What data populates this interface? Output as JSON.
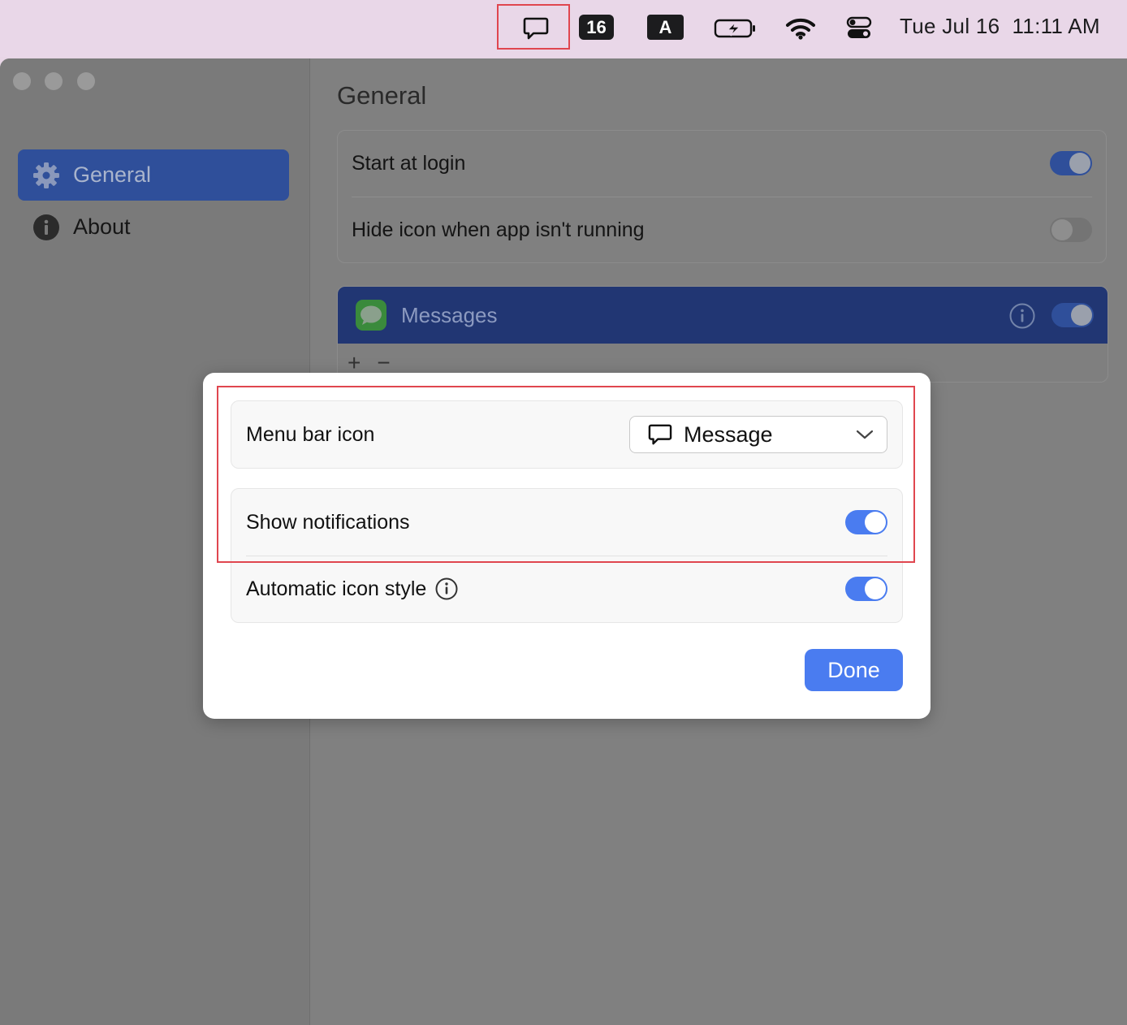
{
  "menubar": {
    "badge_number": "16",
    "input_letter": "A",
    "clock": "Tue Jul 16  11:11 AM",
    "icons": [
      "message-icon",
      "battery-charging-icon",
      "wifi-icon",
      "control-center-icon"
    ]
  },
  "sidebar": {
    "items": [
      {
        "label": "General",
        "icon": "gear-icon",
        "active": true
      },
      {
        "label": "About",
        "icon": "info-icon",
        "active": false
      }
    ]
  },
  "general": {
    "title": "General",
    "start_at_login": {
      "label": "Start at login",
      "on": true
    },
    "hide_icon": {
      "label": "Hide icon when app isn't running",
      "on": false
    }
  },
  "apps": {
    "messages_label": "Messages",
    "messages_on": true,
    "add_symbol": "+",
    "remove_symbol": "−"
  },
  "dialog": {
    "menu_bar_icon_label": "Menu bar icon",
    "menu_bar_icon_value": "Message",
    "show_notifications_label": "Show notifications",
    "show_notifications_on": true,
    "automatic_icon_style_label": "Automatic icon style",
    "automatic_icon_style_on": true,
    "done_label": "Done"
  },
  "colors": {
    "accent": "#4a7cf0",
    "highlight": "#e0464f",
    "menubar_bg": "#e9d7e8"
  }
}
